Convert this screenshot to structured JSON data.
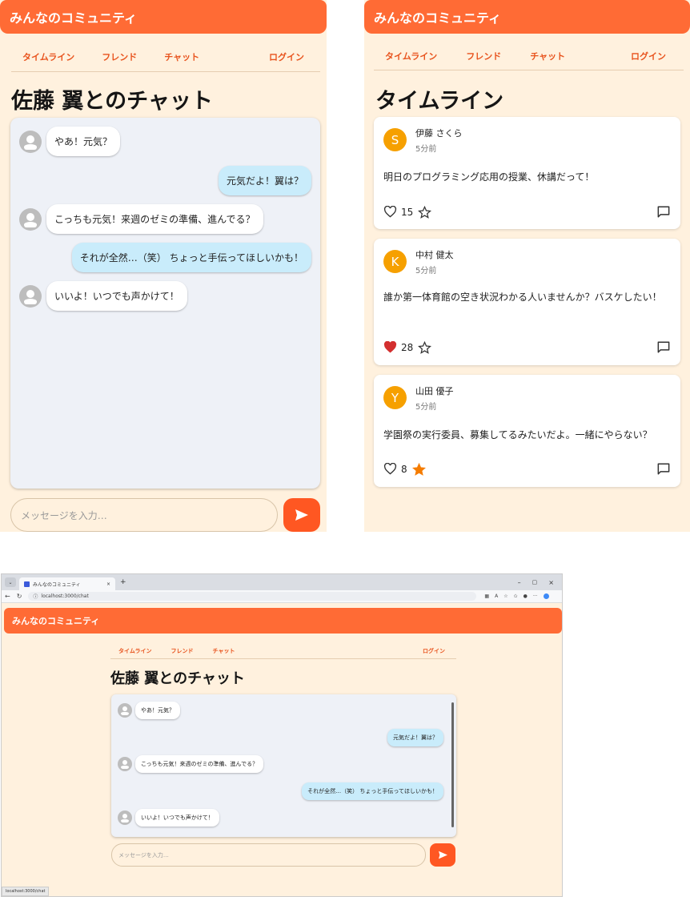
{
  "app": {
    "title": "みんなのコミュニティ"
  },
  "nav": {
    "timeline": "タイムライン",
    "friends": "フレンド",
    "chat": "チャット",
    "login": "ログイン"
  },
  "chat": {
    "title": "佐藤 翼とのチャット",
    "messages": [
      {
        "from": "other",
        "text": "やあ！元気？"
      },
      {
        "from": "me",
        "text": "元気だよ！翼は？"
      },
      {
        "from": "other",
        "text": "こっちも元気！来週のゼミの準備、進んでる？"
      },
      {
        "from": "me",
        "text": "それが全然…（笑） ちょっと手伝ってほしいかも！"
      },
      {
        "from": "other",
        "text": "いいよ！いつでも声かけて！"
      }
    ],
    "input_placeholder": "メッセージを入力…"
  },
  "timeline": {
    "title": "タイムライン",
    "posts": [
      {
        "initial": "S",
        "name": "伊藤 さくら",
        "time": "5分前",
        "text": "明日のプログラミング応用の授業、休講だって！",
        "likes": "15",
        "liked": false,
        "starred": false
      },
      {
        "initial": "K",
        "name": "中村 健太",
        "time": "5分前",
        "text": "誰か第一体育館の空き状況わかる人いませんか？バスケしたい！",
        "likes": "28",
        "liked": true,
        "starred": false
      },
      {
        "initial": "Y",
        "name": "山田 優子",
        "time": "5分前",
        "text": "学園祭の実行委員、募集してるみたいだよ。一緒にやらない？",
        "likes": "8",
        "liked": false,
        "starred": true
      }
    ]
  },
  "browser": {
    "tab_title": "みんなのコミュニティ",
    "url": "localhost:3000/chat",
    "status_url": "localhost:3000/chat"
  },
  "colors": {
    "accent": "#ff6b35",
    "send": "#ff5722",
    "background": "#fff1de",
    "my_bubble": "#c9ecfb",
    "like_active": "#d32f2f",
    "star_active": "#f57c00",
    "avatar": "#f6a000"
  }
}
